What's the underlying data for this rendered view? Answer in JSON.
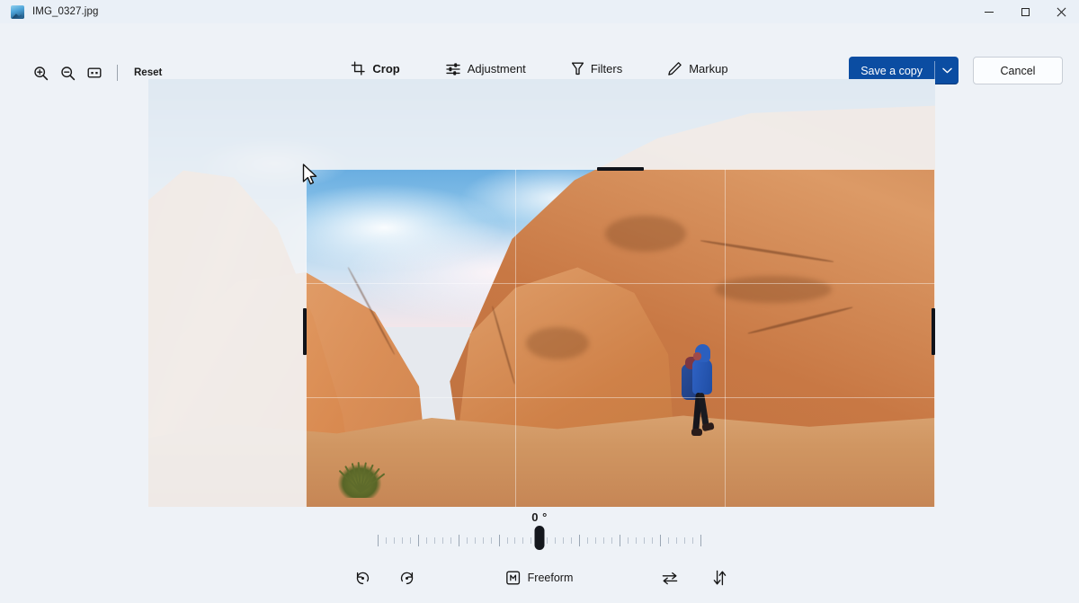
{
  "window": {
    "title": "IMG_0327.jpg",
    "app_icon": "photo-icon",
    "minimize": "minimize-icon",
    "maximize": "maximize-icon",
    "close": "close-icon"
  },
  "toolbar": {
    "zoom_in": "zoom-in-icon",
    "zoom_out": "zoom-out-icon",
    "fit_to_screen": "fit-to-screen-icon",
    "reset_label": "Reset"
  },
  "tools": [
    {
      "label": "Crop",
      "icon": "crop-icon",
      "active": true
    },
    {
      "label": "Adjustment",
      "icon": "adjustment-sliders-icon",
      "active": false
    },
    {
      "label": "Filters",
      "icon": "filters-icon",
      "active": false
    },
    {
      "label": "Markup",
      "icon": "pen-markup-icon",
      "active": false
    }
  ],
  "actions": {
    "save_label": "Save a copy",
    "save_chevron": "chevron-down-icon",
    "cancel_label": "Cancel"
  },
  "rotation": {
    "value_label": "0 °",
    "value": 0,
    "thumb": "slider-thumb"
  },
  "bottom": {
    "rotate_left": "rotate-counterclockwise-icon",
    "rotate_right": "rotate-clockwise-icon",
    "aspect_icon": "aspect-ratio-icon",
    "aspect_label": "Freeform",
    "flip_horizontal": "flip-horizontal-icon",
    "flip_vertical": "flip-vertical-icon"
  },
  "canvas": {
    "cursor": "arrow-cursor",
    "crop_grid": "rule-of-thirds-grid",
    "handles": [
      "top-center",
      "right-center",
      "bottom-center",
      "left-center"
    ]
  },
  "colors": {
    "accent": "#0b4da2",
    "background": "#eef2f7",
    "titlebar": "#eaf0f7",
    "tab_indicator": "#0f2d52",
    "handle": "#10131a"
  }
}
